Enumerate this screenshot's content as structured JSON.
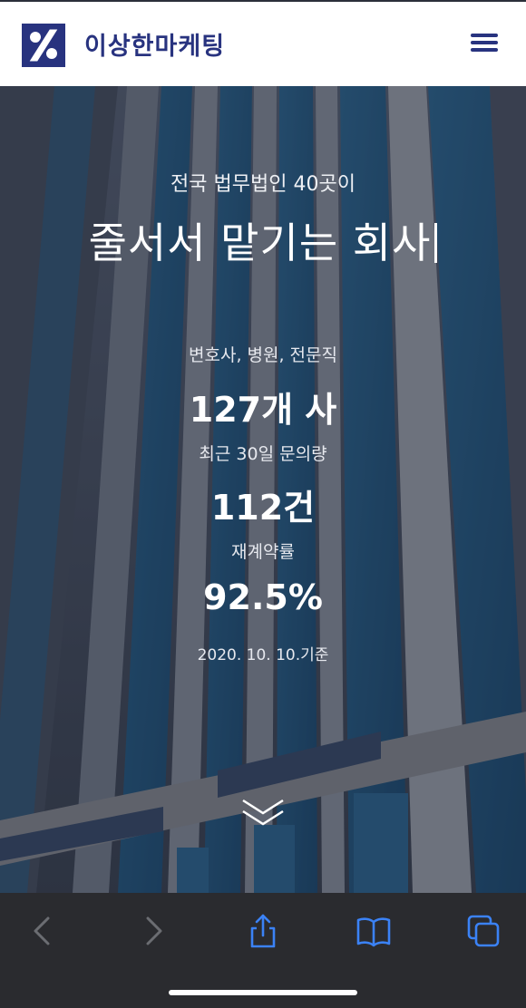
{
  "header": {
    "brand": "이상한마케팅",
    "logo_icon": "brand-logo-icon",
    "menu_icon": "hamburger-menu-icon"
  },
  "hero": {
    "subtitle": "전국 법무법인 40곳이",
    "headline": "줄서서 맡기는 회사",
    "stats": [
      {
        "label": "변호사, 병원, 전문직",
        "value": "127개 사"
      },
      {
        "label": "최근 30일 문의량",
        "value": "112건"
      },
      {
        "label": "재계약률",
        "value": "92.5%"
      }
    ],
    "as_of": "2020. 10. 10.기준",
    "scroll_icon": "chevron-down-icon"
  },
  "toolbar": {
    "items": [
      "back-icon",
      "forward-icon",
      "share-icon",
      "bookmarks-icon",
      "tabs-icon"
    ]
  },
  "colors": {
    "brand": "#28337f",
    "toolbar_bg": "#2a2b2f",
    "toolbar_active": "#3b82f6",
    "toolbar_disabled": "#6b6d72"
  }
}
